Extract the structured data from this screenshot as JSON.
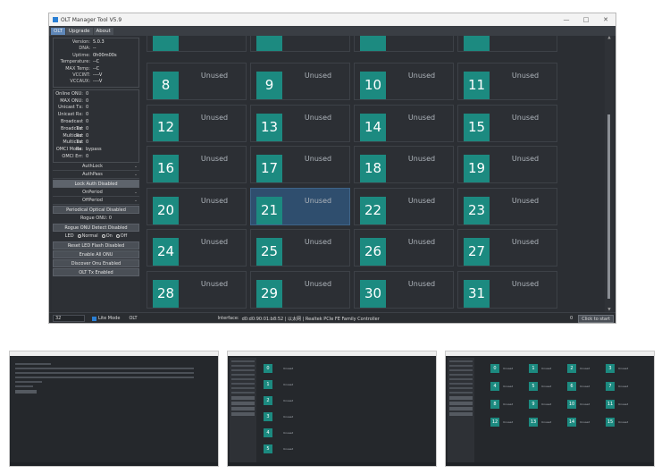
{
  "window": {
    "title": "OLT Manager Tool V5.9",
    "menu": [
      "OLT",
      "Upgrade",
      "About"
    ]
  },
  "sidebar": {
    "info": [
      {
        "label": "Version",
        "value": "5.0.3"
      },
      {
        "label": "DNA",
        "value": "--"
      },
      {
        "label": "Uptime",
        "value": "0h00m00s"
      },
      {
        "label": "Temperature",
        "value": "--C"
      },
      {
        "label": "MAX Temp",
        "value": "--C"
      },
      {
        "label": "VCCINT",
        "value": "----V"
      },
      {
        "label": "VCCAUX",
        "value": "----V"
      }
    ],
    "stats": [
      {
        "label": "Online ONU",
        "value": "0"
      },
      {
        "label": "MAX ONU",
        "value": "0"
      },
      {
        "label": "Unicast Tx",
        "value": "0"
      },
      {
        "label": "Unicast Rx",
        "value": "0"
      },
      {
        "label": "Broadcast Tx",
        "value": "0"
      },
      {
        "label": "Broadcast Rx",
        "value": "0"
      },
      {
        "label": "Multicast Tx",
        "value": "0"
      },
      {
        "label": "Multicast Rx",
        "value": "0"
      },
      {
        "label": "OMCI Mode",
        "value": "bypass"
      },
      {
        "label": "OMCI Err",
        "value": "0"
      }
    ],
    "auth_lock": "AuthLock",
    "auth_pass": "AuthPass",
    "lock_auth_btn": "Lock Auth Disabled",
    "on_period": "OnPeriod",
    "off_period": "OffPeriod",
    "periodical_btn": "Periodical Optical Disabled",
    "rogue_onu": "Rogue ONU: 0",
    "rogue_btn": "Rogue ONU Detect Disabled",
    "led_label": "LED",
    "led_options": [
      "Normal",
      "On",
      "Off"
    ],
    "reset_led_btn": "Reset LED Flash Disabled",
    "enable_all_btn": "Enable All ONU",
    "discover_btn": "Discover Onu Enabled",
    "olt_tx_btn": "OLT Tx Enabled"
  },
  "grid": {
    "cells": [
      {
        "num": "8",
        "status": "Unused"
      },
      {
        "num": "9",
        "status": "Unused"
      },
      {
        "num": "10",
        "status": "Unused"
      },
      {
        "num": "11",
        "status": "Unused"
      },
      {
        "num": "12",
        "status": "Unused"
      },
      {
        "num": "13",
        "status": "Unused"
      },
      {
        "num": "14",
        "status": "Unused"
      },
      {
        "num": "15",
        "status": "Unused"
      },
      {
        "num": "16",
        "status": "Unused"
      },
      {
        "num": "17",
        "status": "Unused"
      },
      {
        "num": "18",
        "status": "Unused"
      },
      {
        "num": "19",
        "status": "Unused"
      },
      {
        "num": "20",
        "status": "Unused"
      },
      {
        "num": "21",
        "status": "Unused"
      },
      {
        "num": "22",
        "status": "Unused"
      },
      {
        "num": "23",
        "status": "Unused"
      },
      {
        "num": "24",
        "status": "Unused"
      },
      {
        "num": "25",
        "status": "Unused"
      },
      {
        "num": "26",
        "status": "Unused"
      },
      {
        "num": "27",
        "status": "Unused"
      },
      {
        "num": "28",
        "status": "Unused"
      },
      {
        "num": "29",
        "status": "Unused"
      },
      {
        "num": "30",
        "status": "Unused"
      },
      {
        "num": "31",
        "status": "Unused"
      }
    ]
  },
  "statusbar": {
    "count": "32",
    "lite_mode": "Lite Mode",
    "olt": "OLT",
    "interface": "Interface:",
    "interface_value": "d0:d0:90:01:b8:52 | 以太网 | Realtek PCIe FE Family Controller",
    "zero": "0",
    "start_btn": "Click to start"
  },
  "thumbs": {
    "thumb2_nums": [
      "0",
      "1",
      "2",
      "3",
      "4",
      "5"
    ],
    "thumb3_nums": [
      "0",
      "1",
      "2",
      "3",
      "4",
      "5",
      "6",
      "7",
      "8",
      "9",
      "10",
      "11",
      "12",
      "13",
      "14",
      "15"
    ],
    "unused": "Unused"
  },
  "colors": {
    "accent": "#1c8a80",
    "highlight": "#2f4e6e",
    "background": "#2b2e33"
  }
}
